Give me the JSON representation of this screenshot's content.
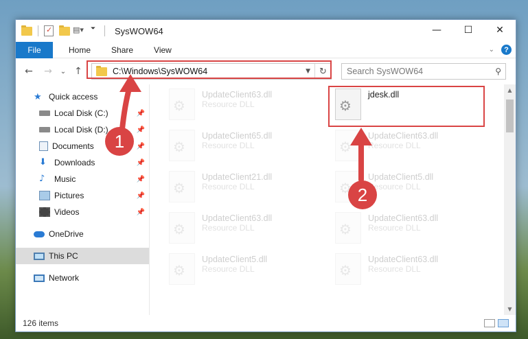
{
  "window": {
    "title": "SysWOW64",
    "controls": {
      "minimize": "—",
      "maximize": "☐",
      "close": "✕"
    }
  },
  "ribbon": {
    "tabs": [
      "File",
      "Home",
      "Share",
      "View"
    ],
    "help": "?"
  },
  "nav": {
    "back": "←",
    "forward": "→",
    "recent": "⌄",
    "up": "↑",
    "address": "C:\\Windows\\SysWOW64",
    "search_placeholder": "Search SysWOW64"
  },
  "sidebar": {
    "items": [
      {
        "label": "Quick access",
        "icon": "star-icon"
      },
      {
        "label": "Local Disk (C:)",
        "icon": "drive-icon",
        "pinned": true
      },
      {
        "label": "Local Disk (D:)",
        "icon": "drive-icon",
        "pinned": true
      },
      {
        "label": "Documents",
        "icon": "documents-icon",
        "pinned": true
      },
      {
        "label": "Downloads",
        "icon": "downloads-icon",
        "pinned": true
      },
      {
        "label": "Music",
        "icon": "music-icon",
        "pinned": true
      },
      {
        "label": "Pictures",
        "icon": "pictures-icon",
        "pinned": true
      },
      {
        "label": "Videos",
        "icon": "videos-icon",
        "pinned": true
      },
      {
        "label": "OneDrive",
        "icon": "onedrive-icon"
      },
      {
        "label": "This PC",
        "icon": "computer-icon",
        "selected": true
      },
      {
        "label": "Network",
        "icon": "network-icon"
      }
    ]
  },
  "files": [
    {
      "name": "UpdateClient63.dll",
      "type": "Resource DLL"
    },
    {
      "name": "jdesk.dll",
      "type": ""
    },
    {
      "name": "UpdateClient65.dll",
      "type": "Resource DLL"
    },
    {
      "name": "UpdateClient63.dll",
      "type": "Resource DLL"
    },
    {
      "name": "UpdateClient21.dll",
      "type": "Resource DLL"
    },
    {
      "name": "UpdateClient5.dll",
      "type": "Resource DLL"
    },
    {
      "name": "UpdateClient63.dll",
      "type": "Resource DLL"
    },
    {
      "name": "UpdateClient63.dll",
      "type": "Resource DLL"
    },
    {
      "name": "UpdateClient5.dll",
      "type": "Resource DLL"
    },
    {
      "name": "UpdateClient63.dll",
      "type": "Resource DLL"
    }
  ],
  "status": {
    "item_count": "126 items"
  },
  "annotations": {
    "step1": "1",
    "step2": "2",
    "color": "#d94444"
  }
}
